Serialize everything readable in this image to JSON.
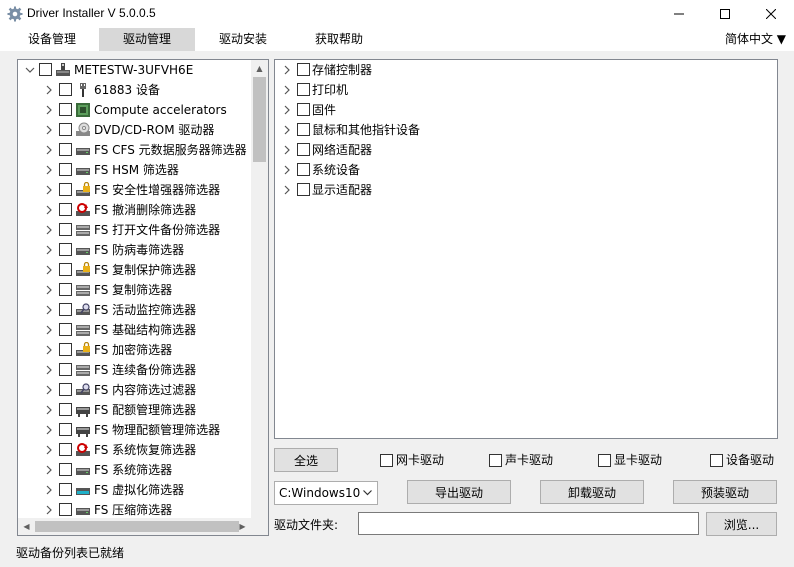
{
  "window": {
    "title": "Driver Installer V 5.0.0.5",
    "minimize_icon": "minimize-icon",
    "maximize_icon": "maximize-icon",
    "close_icon": "close-icon"
  },
  "menu": {
    "items": [
      {
        "label": "设备管理"
      },
      {
        "label": "驱动管理"
      },
      {
        "label": "驱动安装"
      },
      {
        "label": "获取帮助"
      }
    ],
    "active": "驱动管理",
    "language": "简体中文 ▼"
  },
  "tree": {
    "root": {
      "label": "METESTW-3UFVH6E",
      "icon": "computer-icon"
    },
    "items": [
      {
        "label": "61883 设备",
        "icon": "usb-plug-icon"
      },
      {
        "label": "Compute accelerators",
        "icon": "chip-icon"
      },
      {
        "label": "DVD/CD-ROM 驱动器",
        "icon": "disc-drive-icon"
      },
      {
        "label": "FS CFS 元数据服务器筛选器",
        "icon": "filter-driver-icon"
      },
      {
        "label": "FS HSM 筛选器",
        "icon": "filter-driver-icon"
      },
      {
        "label": "FS 安全性增强器筛选器",
        "icon": "lock-icon"
      },
      {
        "label": "FS 撤消删除筛选器",
        "icon": "undelete-icon"
      },
      {
        "label": "FS 打开文件备份筛选器",
        "icon": "backup-drive-icon"
      },
      {
        "label": "FS 防病毒筛选器",
        "icon": "filter-driver-icon"
      },
      {
        "label": "FS 复制保护筛选器",
        "icon": "lock-icon"
      },
      {
        "label": "FS 复制筛选器",
        "icon": "backup-drive-icon"
      },
      {
        "label": "FS 活动监控筛选器",
        "icon": "monitor-magnifier-icon"
      },
      {
        "label": "FS 基础结构筛选器",
        "icon": "backup-drive-icon"
      },
      {
        "label": "FS 加密筛选器",
        "icon": "lock-icon"
      },
      {
        "label": "FS 连续备份筛选器",
        "icon": "backup-drive-icon"
      },
      {
        "label": "FS 内容筛选过滤器",
        "icon": "monitor-magnifier-icon"
      },
      {
        "label": "FS 配额管理筛选器",
        "icon": "quota-drive-icon"
      },
      {
        "label": "FS 物理配额管理筛选器",
        "icon": "quota-drive-icon"
      },
      {
        "label": "FS 系统恢复筛选器",
        "icon": "undelete-icon"
      },
      {
        "label": "FS 系统筛选器",
        "icon": "filter-driver-icon"
      },
      {
        "label": "FS 虚拟化筛选器",
        "icon": "virtual-drive-icon"
      },
      {
        "label": "FS 压缩筛选器",
        "icon": "filter-driver-icon"
      }
    ]
  },
  "right_tree": {
    "items": [
      {
        "label": "存储控制器"
      },
      {
        "label": "打印机"
      },
      {
        "label": "固件"
      },
      {
        "label": "鼠标和其他指针设备"
      },
      {
        "label": "网络适配器"
      },
      {
        "label": "系统设备"
      },
      {
        "label": "显示适配器"
      }
    ]
  },
  "actions": {
    "select_all": "全选",
    "filters": [
      {
        "label": "网卡驱动",
        "checked": false
      },
      {
        "label": "声卡驱动",
        "checked": false
      },
      {
        "label": "显卡驱动",
        "checked": false
      },
      {
        "label": "设备驱动",
        "checked": false
      }
    ],
    "os_select": "C:Windows10",
    "export": "导出驱动",
    "uninstall": "卸载驱动",
    "preinstall": "预装驱动",
    "path_label": "驱动文件夹:",
    "path_value": "",
    "browse": "浏览..."
  },
  "status": {
    "text": "驱动备份列表已就绪"
  }
}
